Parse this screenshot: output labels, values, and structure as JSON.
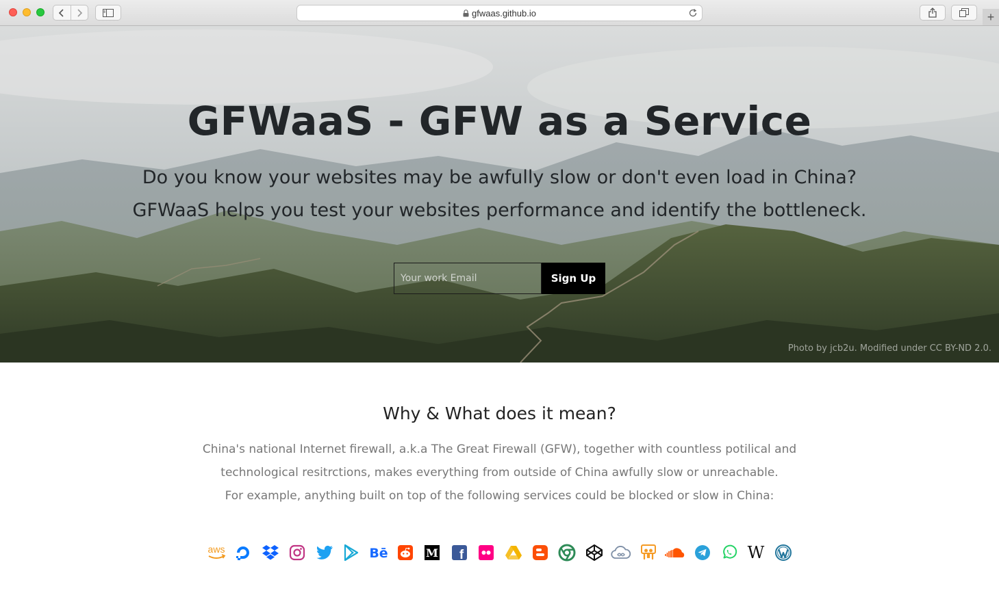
{
  "browser": {
    "url": "gfwaas.github.io",
    "icons": {
      "back": "chevron-left-icon",
      "forward": "chevron-right-icon",
      "sidebar": "sidebar-icon",
      "lock": "lock-icon",
      "reload": "reload-icon",
      "share": "share-icon",
      "tabs": "tabs-overview-icon",
      "new_tab": "plus-icon"
    },
    "new_tab_label": "+"
  },
  "hero": {
    "title": "GFWaaS - GFW as a Service",
    "subtitle_line1": "Do you know your websites may be awfully slow or don't even load in China?",
    "subtitle_line2": "GFWaaS helps you test your websites performance and identify the bottleneck.",
    "email_placeholder": "Your work Email",
    "email_value": "",
    "signup_label": "Sign Up",
    "photo_credit": "Photo by jcb2u. Modified under CC BY-ND 2.0."
  },
  "why": {
    "title": "Why & What does it mean?",
    "line1": "China's national Internet firewall, a.k.a The Great Firewall (GFW), together with countless potilical and",
    "line2": "technological resitrctions, makes everything from outside of China awfully slow or unreachable.",
    "line3": "For example, anything built on top of the following services could be blocked or slow in China:"
  },
  "services": [
    {
      "name": "aws-icon",
      "color": "#f39a1e"
    },
    {
      "name": "digitalocean-icon",
      "color": "#0a7bff"
    },
    {
      "name": "dropbox-icon",
      "color": "#0d62ff"
    },
    {
      "name": "instagram-icon",
      "color": "#c13584"
    },
    {
      "name": "twitter-icon",
      "color": "#1da1f2"
    },
    {
      "name": "google-play-icon",
      "color": "#18a9d6"
    },
    {
      "name": "behance-icon",
      "color": "#1769ff"
    },
    {
      "name": "reddit-icon",
      "color": "#ff4500"
    },
    {
      "name": "medium-icon",
      "color": "#000000"
    },
    {
      "name": "facebook-icon",
      "color": "#3b5998"
    },
    {
      "name": "flickr-icon",
      "color": "#ff0084"
    },
    {
      "name": "google-drive-icon",
      "color": "#f4b400"
    },
    {
      "name": "blogger-icon",
      "color": "#fc4f08"
    },
    {
      "name": "chrome-icon",
      "color": "#2e8b57"
    },
    {
      "name": "codepen-icon",
      "color": "#111111"
    },
    {
      "name": "cloud-icon",
      "color": "#7e8fa6"
    },
    {
      "name": "slideshare-icon",
      "color": "#f59a23"
    },
    {
      "name": "soundcloud-icon",
      "color": "#ff5500"
    },
    {
      "name": "telegram-icon",
      "color": "#2aa1da"
    },
    {
      "name": "whatsapp-icon",
      "color": "#25d366"
    },
    {
      "name": "wikipedia-icon",
      "color": "#111111"
    },
    {
      "name": "wordpress-icon",
      "color": "#21759b"
    }
  ],
  "service_labels": {
    "aws": "aws",
    "behance": "Bē",
    "medium": "M",
    "facebook": "f",
    "blogger": "B",
    "wikipedia": "W"
  }
}
